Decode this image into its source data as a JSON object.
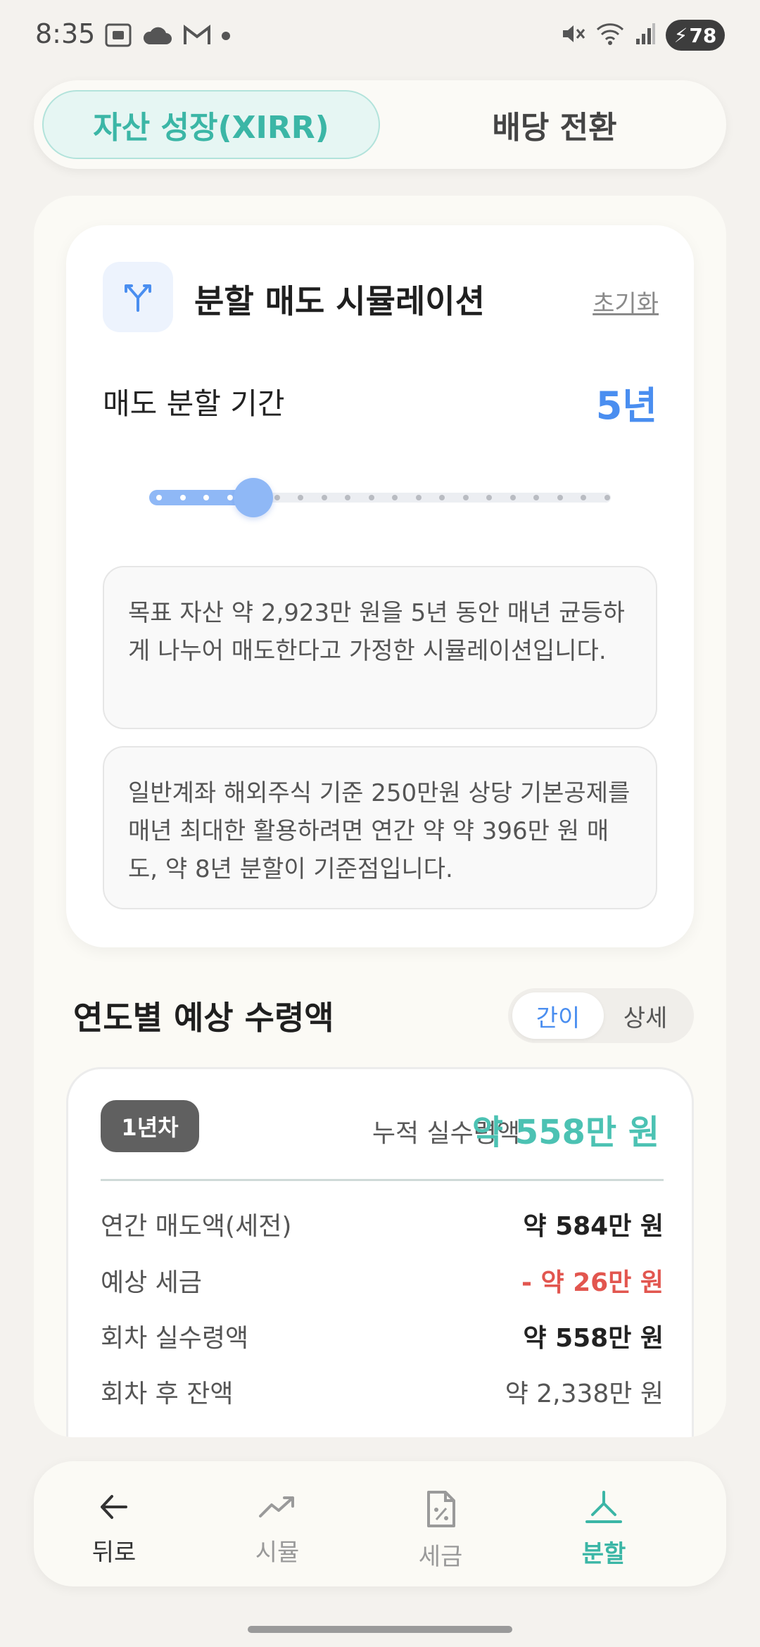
{
  "status_bar": {
    "time": "8:35",
    "battery": "78",
    "icons": [
      "screenshot-icon",
      "cloud-icon",
      "gmail-icon",
      "dot-icon",
      "mute-icon",
      "wifi-icon",
      "signal-icon",
      "battery-charging-icon"
    ]
  },
  "tabs": [
    {
      "label": "자산 성장(XIRR)",
      "active": true
    },
    {
      "label": "배당 전환",
      "active": false
    }
  ],
  "simulation": {
    "icon": "split-arrows-icon",
    "title": "분할 매도 시뮬레이션",
    "reset_label": "초기화",
    "period_label": "매도 분할 기간",
    "period_value": "5년",
    "slider": {
      "value": 5,
      "min": 1,
      "max": 20
    },
    "note1": "목표 자산 약 2,923만 원을 5년 동안 매년 균등하게 나누어 매도한다고 가정한 시뮬레이션입니다.",
    "note2": "일반계좌 해외주식 기준 250만원 상당 기본공제를 매년 최대한 활용하려면 연간 약 약 396만 원 매도, 약 8년 분할이 기준점입니다."
  },
  "yearly": {
    "title": "연도별 예상 수령액",
    "toggle": {
      "simple": "간이",
      "detail": "상세",
      "selected": "간이"
    },
    "card": {
      "badge": "1년차",
      "cumulative_label": "누적 실수령액",
      "cumulative_value": "약 558만 원",
      "rows": [
        {
          "label": "연간 매도액(세전)",
          "value": "약 584만 원"
        },
        {
          "label": "예상 세금",
          "value": "- 약 26만 원"
        },
        {
          "label": "회차 실수령액",
          "value": "약 558만 원"
        },
        {
          "label": "회차 후 잔액",
          "value": "약 2,338만 원"
        }
      ]
    }
  },
  "nav": [
    {
      "label": "뒤로",
      "icon": "back-arrow-icon"
    },
    {
      "label": "시뮬",
      "icon": "trend-up-icon"
    },
    {
      "label": "세금",
      "icon": "tax-document-icon"
    },
    {
      "label": "분할",
      "icon": "split-icon",
      "active": true
    }
  ],
  "colors": {
    "accent_teal": "#3bb6a6",
    "accent_blue": "#4a8ef0",
    "tax_red": "#e2564f"
  }
}
